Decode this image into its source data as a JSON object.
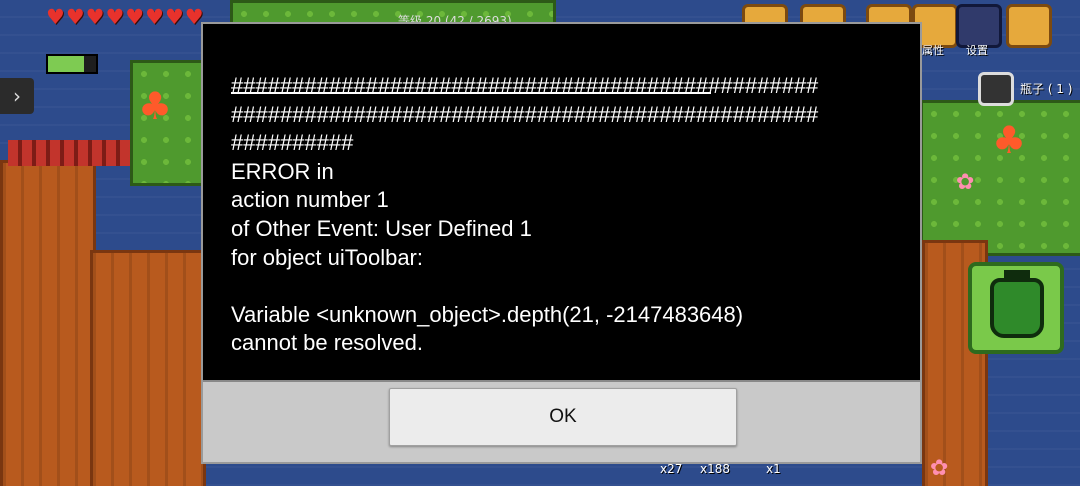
{
  "game": {
    "hearts": "♥♥♥♥♥♥♥♥",
    "stamina_fraction": 0.75,
    "side_arrow": "›",
    "top_bar_text": "等级 20 (42 / 2693)",
    "toolbar": {
      "attributes_label": "属性",
      "settings_label": "设置"
    },
    "selected_item_label": "瓶子 ( 1 )",
    "hotbar_counts": [
      "x27",
      "x188",
      "x1"
    ]
  },
  "dialog": {
    "message": "################################################\n################################################\n##########\nERROR in\naction number 1\nof Other Event: User Defined 1\nfor object uiToolbar:\n\nVariable <unknown_object>.depth(21, -2147483648)\ncannot be resolved.",
    "ok_label": "OK"
  },
  "colors": {
    "dialog_bg": "#000000",
    "button_bar_bg": "#c9c9c9",
    "button_bg": "#ececec"
  }
}
